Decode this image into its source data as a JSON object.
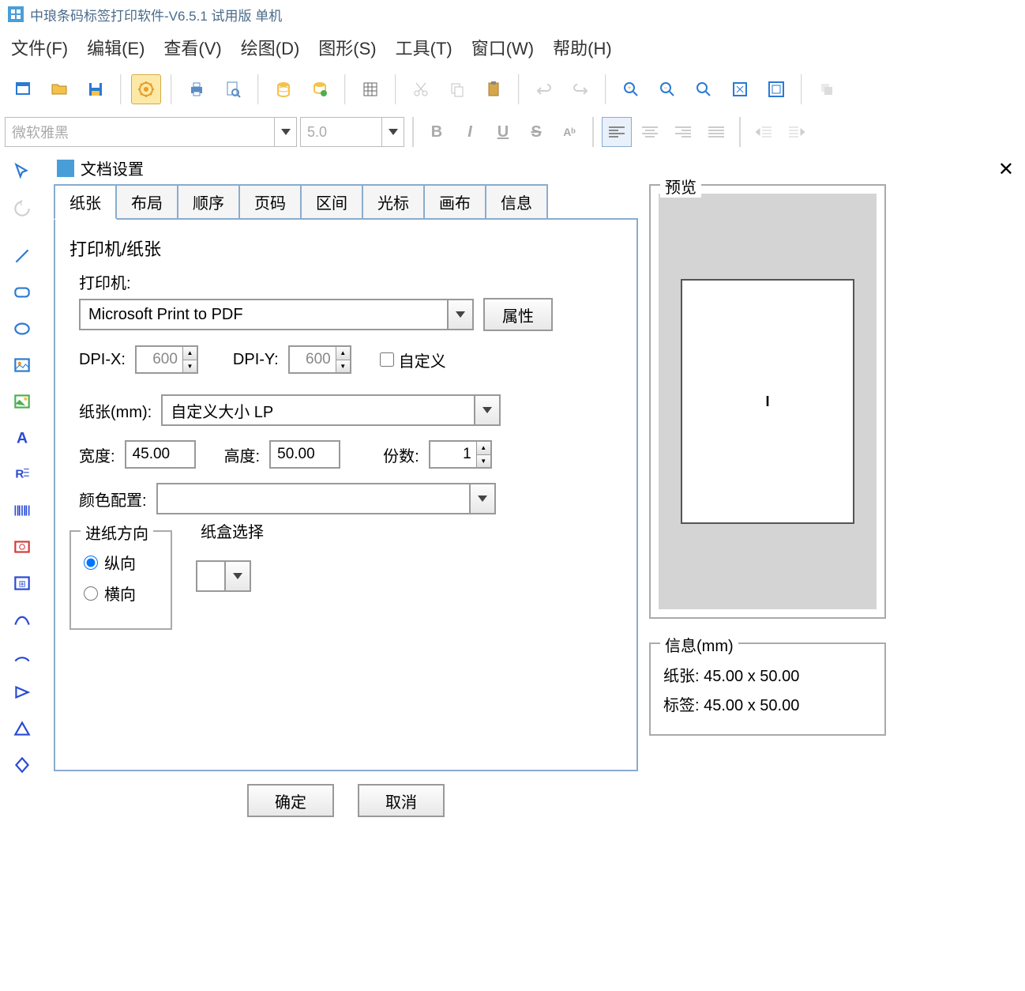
{
  "app": {
    "title": "中琅条码标签打印软件-V6.5.1 试用版 单机"
  },
  "menubar": {
    "items": [
      {
        "label": "文件(F)"
      },
      {
        "label": "编辑(E)"
      },
      {
        "label": "查看(V)"
      },
      {
        "label": "绘图(D)"
      },
      {
        "label": "图形(S)"
      },
      {
        "label": "工具(T)"
      },
      {
        "label": "窗口(W)"
      },
      {
        "label": "帮助(H)"
      }
    ]
  },
  "format": {
    "font_name": "微软雅黑",
    "font_size": "5.0"
  },
  "dialog": {
    "title": "文档设置",
    "tabs": [
      {
        "label": "纸张"
      },
      {
        "label": "布局"
      },
      {
        "label": "顺序"
      },
      {
        "label": "页码"
      },
      {
        "label": "区间"
      },
      {
        "label": "光标"
      },
      {
        "label": "画布"
      },
      {
        "label": "信息"
      }
    ],
    "printer_group": "打印机/纸张",
    "printer_label": "打印机:",
    "printer_value": "Microsoft Print to PDF",
    "properties_btn": "属性",
    "dpi_x_label": "DPI-X:",
    "dpi_x_value": "600",
    "dpi_y_label": "DPI-Y:",
    "dpi_y_value": "600",
    "custom_label": "自定义",
    "paper_label": "纸张(mm):",
    "paper_value": "自定义大小 LP",
    "width_label": "宽度:",
    "width_value": "45.00",
    "height_label": "高度:",
    "height_value": "50.00",
    "copies_label": "份数:",
    "copies_value": "1",
    "color_label": "颜色配置:",
    "color_value": "",
    "feed_group": "进纸方向",
    "feed_portrait": "纵向",
    "feed_landscape": "横向",
    "tray_group": "纸盒选择",
    "ok_btn": "确定",
    "cancel_btn": "取消"
  },
  "preview": {
    "title": "预览",
    "page_mark": "I"
  },
  "info": {
    "title": "信息(mm)",
    "paper_label": "纸张:",
    "paper_value": "45.00 x 50.00",
    "label_label": "标签:",
    "label_value": "45.00 x 50.00"
  }
}
